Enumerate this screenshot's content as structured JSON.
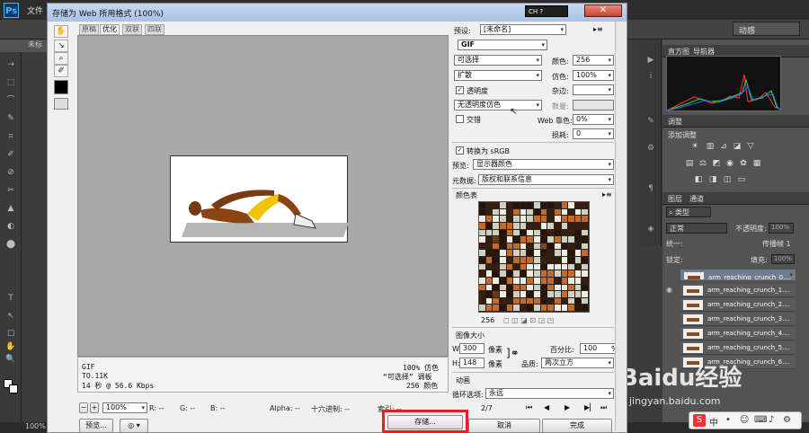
{
  "ps": {
    "logo": "Ps",
    "menu_file": "文件",
    "tab_label": "未标",
    "zoom_bottom": "100%",
    "workspace": "动感",
    "tools": [
      "⇢",
      "⬚",
      "⌒",
      "✎",
      "⌗",
      "✐",
      "⊘",
      "✂",
      "▲",
      "◐",
      "⬤",
      "T",
      "↖",
      "☐",
      "✋",
      "🔍"
    ]
  },
  "right_panel": {
    "tabs_top": [
      "直方图",
      "导航器"
    ],
    "adjust_tab": "调整",
    "adjust_label": "添加调整",
    "layers_tabs": [
      "图层",
      "通道"
    ],
    "kind": "类型",
    "blend": "正常",
    "opacity_label": "不透明度:",
    "opacity": "100%",
    "lock_label": "锁定:",
    "fill_label": "填充:",
    "fill": "100%",
    "propagate": "传播帧 1",
    "unify": "统一:",
    "layers": [
      "arm_reaching_crunch_0....",
      "arm_reaching_crunch_1....",
      "arm_reaching_crunch_2....",
      "arm_reaching_crunch_3....",
      "arm_reaching_crunch_4....",
      "arm_reaching_crunch_5....",
      "arm_reaching_crunch_6...."
    ]
  },
  "dialog": {
    "title": "存储为 Web 所用格式 (100%)",
    "ch_label": "CH",
    "view_tabs": [
      "原稿",
      "优化",
      "双联",
      "四联"
    ],
    "info": {
      "format": "GIF",
      "size": "TO.11K",
      "time": "14 秒 @ 56.6 Kbps",
      "dither": "100% 仿色",
      "palette": "“可选择” 调板",
      "colors": "256 颜色"
    },
    "zoom": "100%",
    "stats": {
      "r": "R: --",
      "g": "G: --",
      "b": "B: --",
      "alpha": "Alpha: --",
      "hex": "十六进制: --",
      "index": "索引: --"
    },
    "frame": "2/7",
    "buttons": {
      "preview": "预览...",
      "save": "存储...",
      "cancel": "取消",
      "done": "完成"
    }
  },
  "settings": {
    "preset_label": "预设:",
    "preset": "[未命名]",
    "format": "GIF",
    "reduction": "可选择",
    "colors_label": "颜色:",
    "colors": "256",
    "dither_algo": "扩散",
    "dither_label": "仿色:",
    "dither": "100%",
    "transparency": "透明度",
    "matte_label": "杂边:",
    "trans_dither": "无透明度仿色",
    "amount_label": "数量:",
    "interlaced": "交错",
    "websnap_label": "Web 靠色:",
    "websnap": "0%",
    "lossy_label": "损耗:",
    "lossy": "0",
    "convert_srgb": "转换为 sRGB",
    "preview_label": "预览:",
    "preview": "显示器颜色",
    "metadata_label": "元数据:",
    "metadata": "版权和联系信息",
    "colortable_label": "颜色表",
    "colortable_count": "256",
    "image_size_label": "图像大小",
    "w_label": "W:",
    "w": "300",
    "h_label": "H:",
    "h": "148",
    "px": "像素",
    "percent_label": "百分比:",
    "percent": "100",
    "percent_unit": "%",
    "quality_label": "品质:",
    "quality": "两次立方",
    "animation_label": "动画",
    "loop_label": "循环选项:",
    "loop": "永远"
  },
  "watermark": {
    "logo": "Baidu经验",
    "url": "jingyan.baidu.com"
  },
  "colors": {
    "save_highlight": "#e42020"
  }
}
